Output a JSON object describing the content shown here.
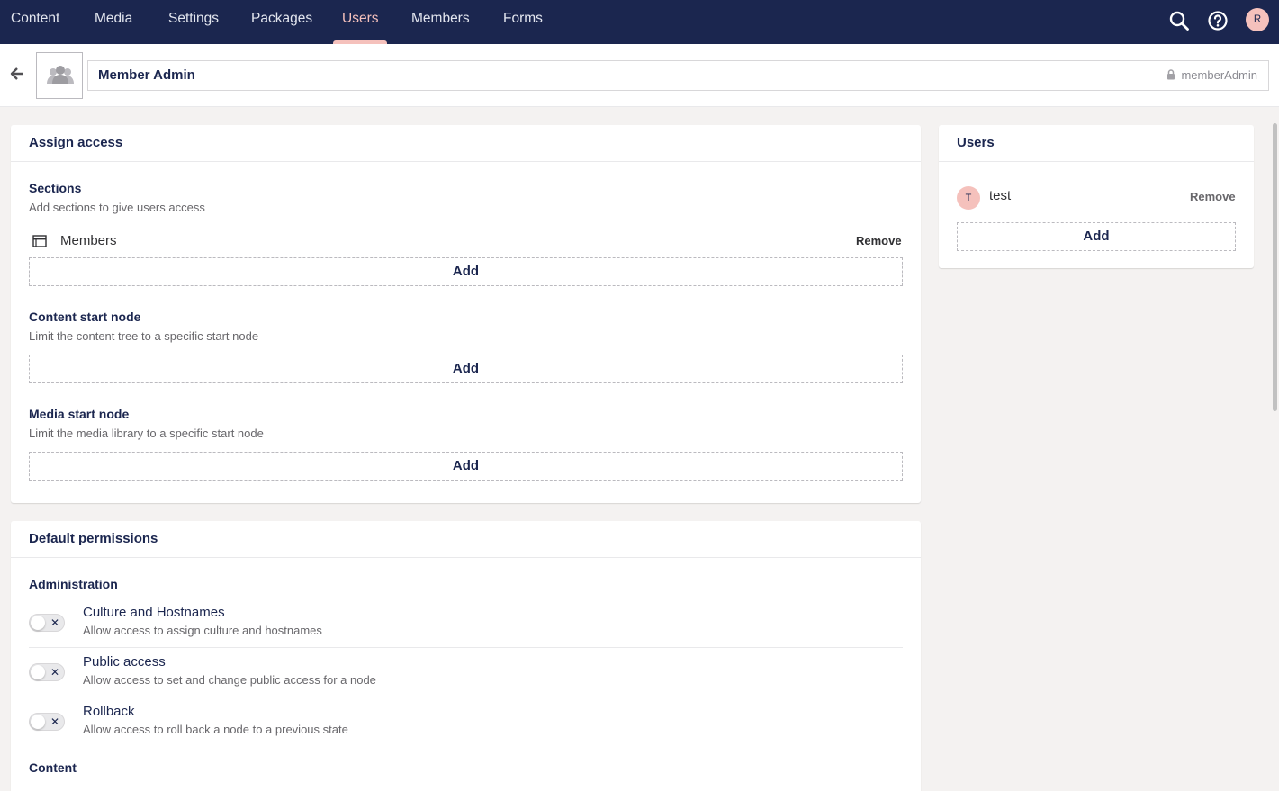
{
  "nav": {
    "items": [
      {
        "label": "Content"
      },
      {
        "label": "Media"
      },
      {
        "label": "Settings"
      },
      {
        "label": "Packages"
      },
      {
        "label": "Users"
      },
      {
        "label": "Members"
      },
      {
        "label": "Forms"
      }
    ],
    "active": "Users",
    "avatar_initial": "R"
  },
  "header": {
    "group_name": "Member Admin",
    "alias": "memberAdmin"
  },
  "assign_access": {
    "title": "Assign access",
    "sections": {
      "label": "Sections",
      "description": "Add sections to give users access",
      "items": [
        {
          "name": "Members",
          "remove_label": "Remove"
        }
      ],
      "add_label": "Add"
    },
    "content_start_node": {
      "label": "Content start node",
      "description": "Limit the content tree to a specific start node",
      "add_label": "Add"
    },
    "media_start_node": {
      "label": "Media start node",
      "description": "Limit the media library to a specific start node",
      "add_label": "Add"
    }
  },
  "users_panel": {
    "title": "Users",
    "users": [
      {
        "initial": "T",
        "name": "test",
        "remove_label": "Remove"
      }
    ],
    "add_label": "Add"
  },
  "default_permissions": {
    "title": "Default permissions",
    "groups": [
      {
        "label": "Administration",
        "permissions": [
          {
            "name": "Culture and Hostnames",
            "description": "Allow access to assign culture and hostnames",
            "enabled": false
          },
          {
            "name": "Public access",
            "description": "Allow access to set and change public access for a node",
            "enabled": false
          },
          {
            "name": "Rollback",
            "description": "Allow access to roll back a node to a previous state",
            "enabled": false
          }
        ]
      },
      {
        "label": "Content"
      }
    ],
    "toggle_off_glyph": "✕"
  },
  "colors": {
    "nav_bg": "#1b264f",
    "nav_active": "#f5c1bc",
    "page_bg": "#f4f2f1",
    "text_primary": "#1b264f"
  }
}
